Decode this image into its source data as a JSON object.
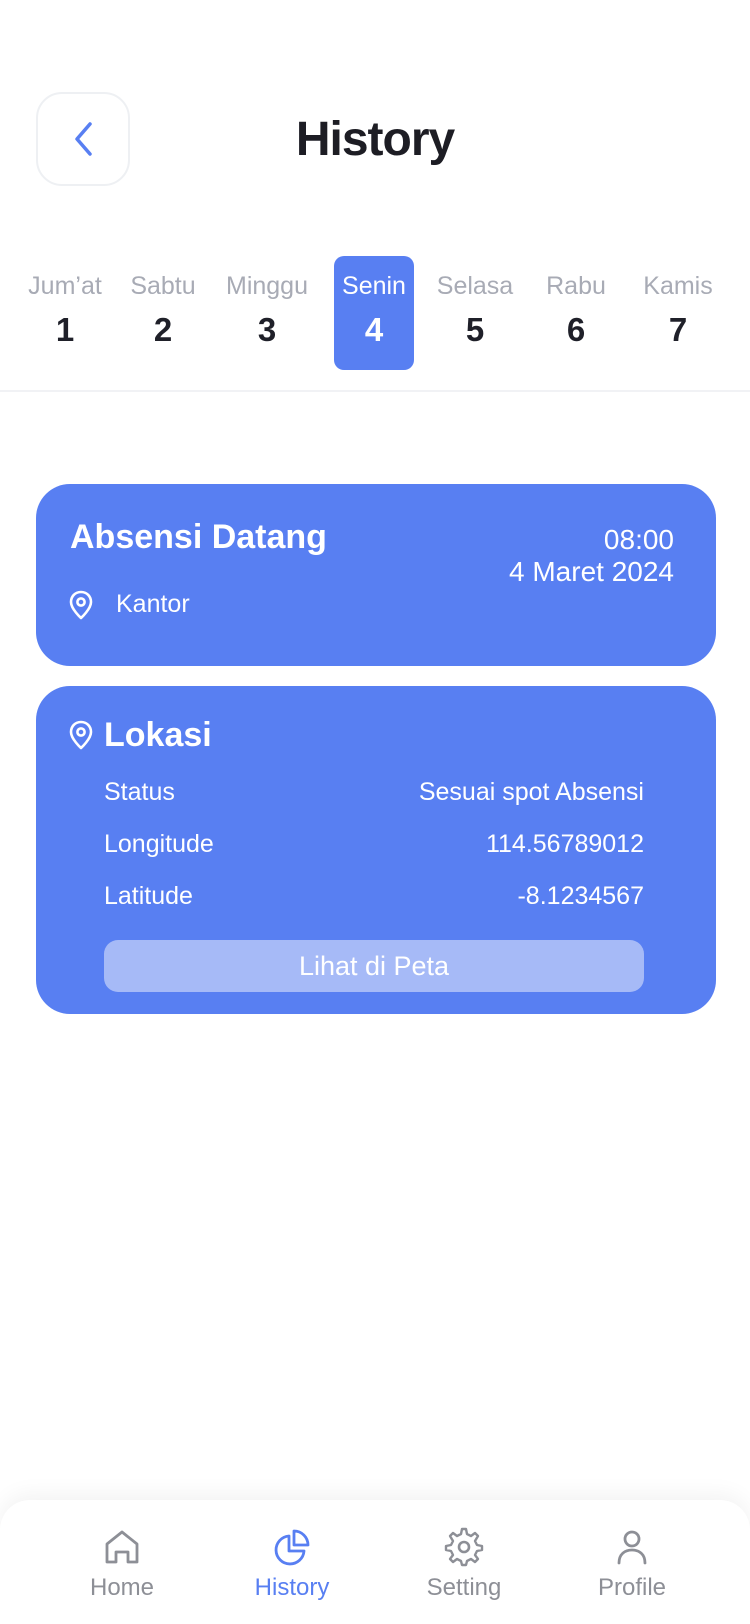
{
  "header": {
    "title": "History",
    "back_icon": "chevron-left-icon"
  },
  "days": [
    {
      "name": "Jum’at",
      "num": "1"
    },
    {
      "name": "Sabtu",
      "num": "2"
    },
    {
      "name": "Minggu",
      "num": "3"
    },
    {
      "name": "Senin",
      "num": "4",
      "selected": true
    },
    {
      "name": "Selasa",
      "num": "5"
    },
    {
      "name": "Rabu",
      "num": "6"
    },
    {
      "name": "Kamis",
      "num": "7"
    }
  ],
  "checkin": {
    "title": "Absensi Datang",
    "time": "08:00",
    "date": "4 Maret 2024",
    "place": "Kantor",
    "place_icon": "location-pin-icon"
  },
  "location": {
    "title": "Lokasi",
    "icon": "location-pin-icon",
    "rows": [
      {
        "label": "Status",
        "value": "Sesuai spot Absensi"
      },
      {
        "label": "Longitude",
        "value": "114.56789012"
      },
      {
        "label": "Latitude",
        "value": "-8.1234567"
      }
    ],
    "map_button": "Lihat di Peta"
  },
  "nav": {
    "items": [
      {
        "label": "Home",
        "icon": "home-icon"
      },
      {
        "label": "History",
        "icon": "pie-chart-icon",
        "active": true
      },
      {
        "label": "Setting",
        "icon": "gear-icon"
      },
      {
        "label": "Profile",
        "icon": "user-icon"
      }
    ]
  },
  "colors": {
    "accent": "#587ff2",
    "map_button": "#a6baf7",
    "muted_text": "#a8abb5",
    "nav_inactive": "#8d8f96"
  }
}
